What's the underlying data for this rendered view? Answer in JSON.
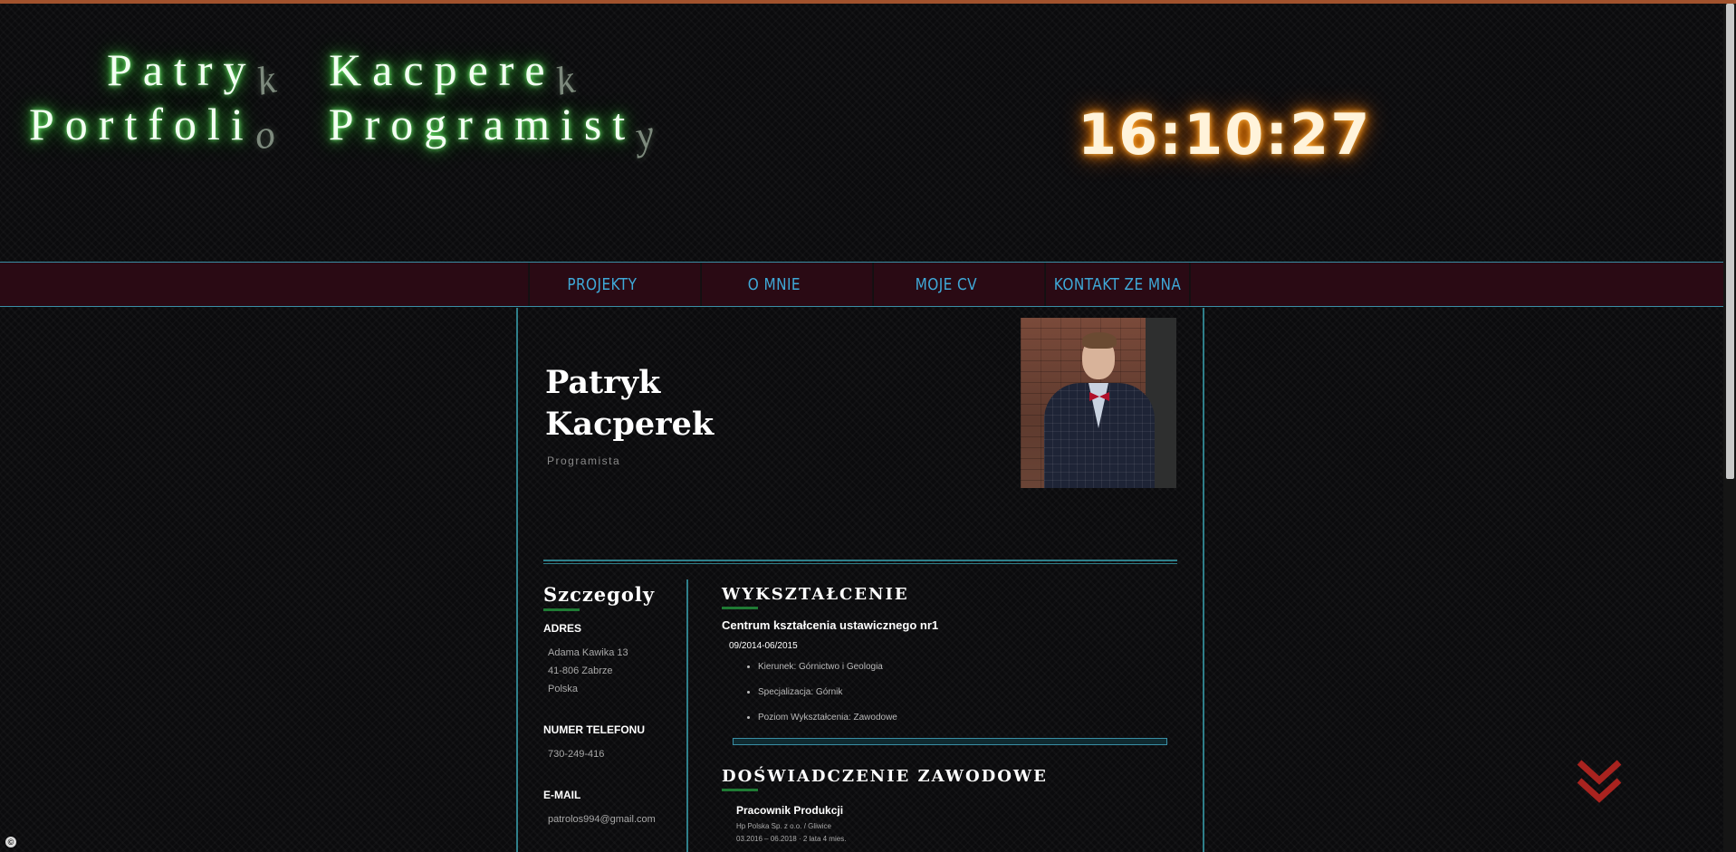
{
  "header": {
    "title_line1": [
      {
        "text": "Patry",
        "drop": "k"
      },
      {
        "text": "Kacpere",
        "drop": "k"
      }
    ],
    "title_line2": [
      {
        "text": "Portfoli",
        "drop": "o"
      },
      {
        "text": "Programist",
        "drop": "y"
      }
    ],
    "clock": "16:10:27"
  },
  "nav": {
    "items": [
      "PROJEKTY",
      "O MNIE",
      "MOJE CV",
      "KONTAKT ZE MNA"
    ]
  },
  "profile": {
    "first_name": "Patryk",
    "last_name": "Kacperek",
    "role": "Programista"
  },
  "details": {
    "heading": "Szczegoly",
    "address_label": "ADRES",
    "address_lines": [
      "Adama Kawika 13",
      "41-806 Zabrze",
      "Polska"
    ],
    "phone_label": "NUMER TELEFONU",
    "phone": "730-249-416",
    "email_label": "E-MAIL",
    "email": "patrolos994@gmail.com"
  },
  "education": {
    "heading": "WYKSZTAŁCENIE",
    "school": "Centrum kształcenia ustawicznego nr1",
    "dates": "09/2014-06/2015",
    "items": [
      "Kierunek: Górnictwo i Geologia",
      "Specjalizacja: Górnik",
      "Poziom Wykształcenia: Zawodowe"
    ]
  },
  "experience": {
    "heading": "DOŚWIADCZENIE ZAWODOWE",
    "job_title": "Pracownik Produkcji",
    "company": "Hp Polska Sp. z o.o. / Gliwice",
    "dates": "03.2016 – 06.2018 · 2 lata 4 mies."
  },
  "colors": {
    "accent_teal": "#2f7f8a",
    "nav_text": "#3fa9d8",
    "nav_bg": "#2a0a14",
    "title_glow": "#3bd43b",
    "clock_glow": "#ff8c00",
    "arrow": "#a8231f"
  },
  "icons": {
    "scroll_down": "double-chevron-down-icon",
    "corner": "copyright-icon"
  }
}
